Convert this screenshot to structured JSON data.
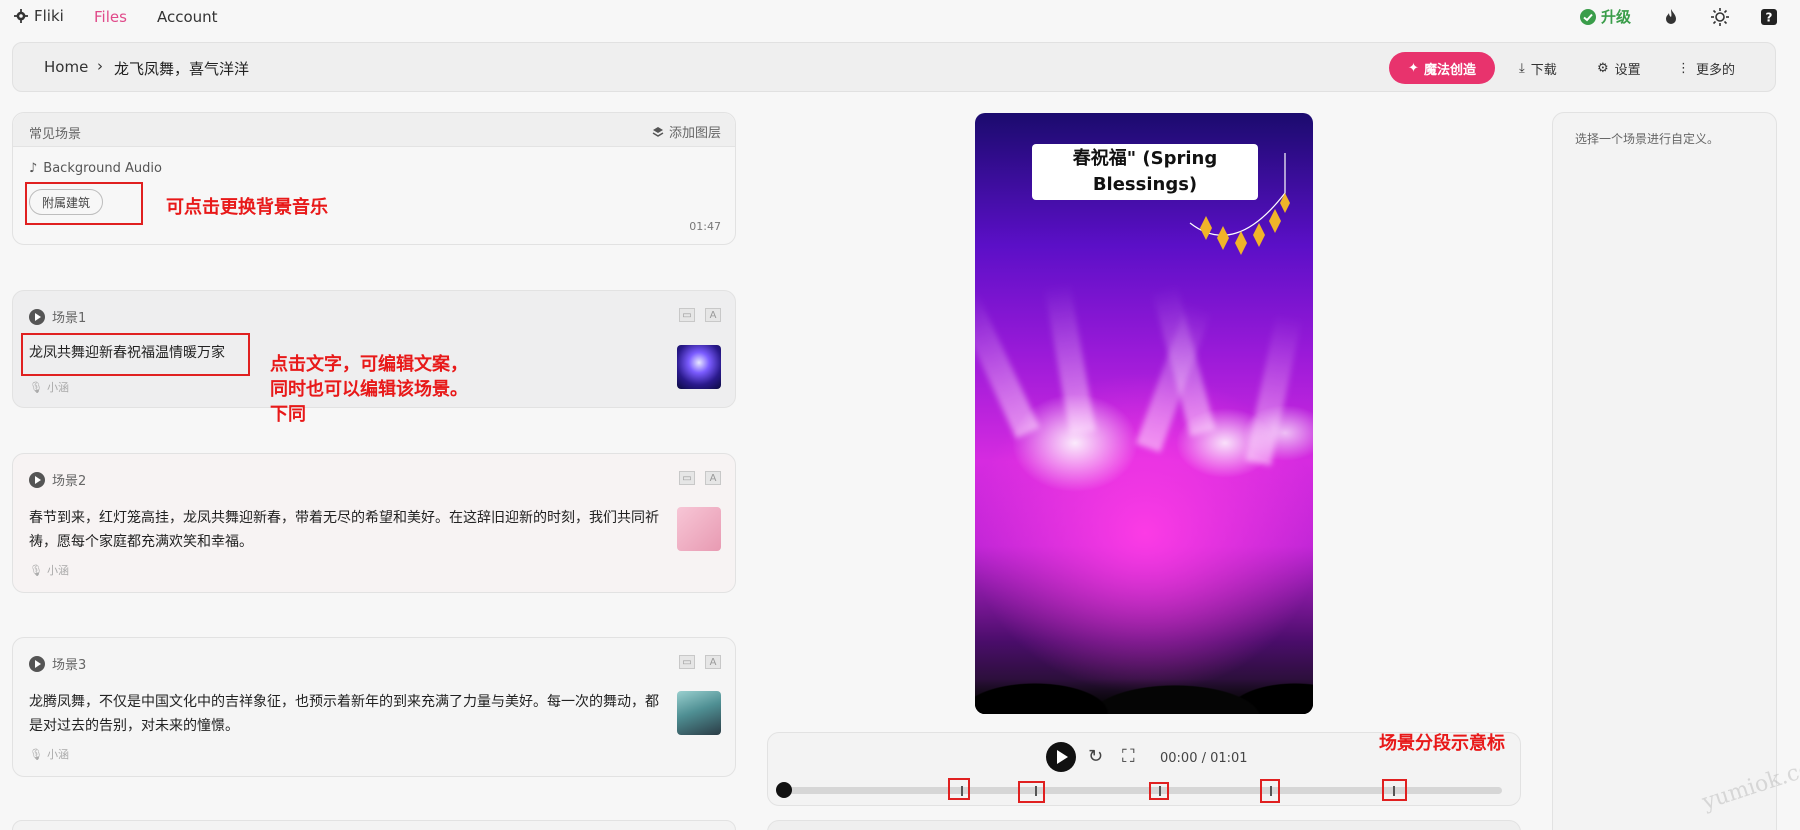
{
  "nav": {
    "brand": "Fliki",
    "files": "Files",
    "account": "Account",
    "upgrade": "升级"
  },
  "breadcrumb": {
    "home": "Home",
    "sep": "›",
    "project": "龙飞凤舞，喜气洋洋"
  },
  "toolbar": {
    "magic": "魔法创造",
    "download": "下载",
    "settings": "设置",
    "more": "更多的"
  },
  "common": {
    "title": "常见场景",
    "add_layer": "添加图层",
    "bg_audio": "Background Audio",
    "chip": "附属建筑",
    "duration": "01:47"
  },
  "scenes": [
    {
      "label": "场景1",
      "text": "龙凤共舞迎新春祝福温情暖万家",
      "voice": "小涵"
    },
    {
      "label": "场景2",
      "text": "春节到来，红灯笼高挂，龙凤共舞迎新春，带着无尽的希望和美好。在这辞旧迎新的时刻，我们共同祈祷，愿每个家庭都充满欢笑和幸福。",
      "voice": "小涵"
    },
    {
      "label": "场景3",
      "text": "龙腾凤舞，不仅是中国文化中的吉祥象征，也预示着新年的到来充满了力量与美好。每一次的舞动，都是对过去的告别，对未来的憧憬。",
      "voice": "小涵"
    }
  ],
  "annotations": {
    "bg_music": "可点击更换背景音乐",
    "edit_line1": "点击文字，可编辑文案，",
    "edit_line2": "同时也可以编辑该场景。",
    "edit_line3": "下同",
    "segments": "场景分段示意标"
  },
  "video": {
    "title": "春祝福\" (Spring Blessings)"
  },
  "player": {
    "timecode": "00:00 / 01:01",
    "progress": 0
  },
  "right_panel": {
    "hint": "选择一个场景进行自定义。"
  },
  "watermark": "yumiok.com",
  "colors": {
    "accent": "#e8336d",
    "files_link": "#e04a8a",
    "upgrade": "#3a9d4a",
    "annotation": "#e81919"
  }
}
